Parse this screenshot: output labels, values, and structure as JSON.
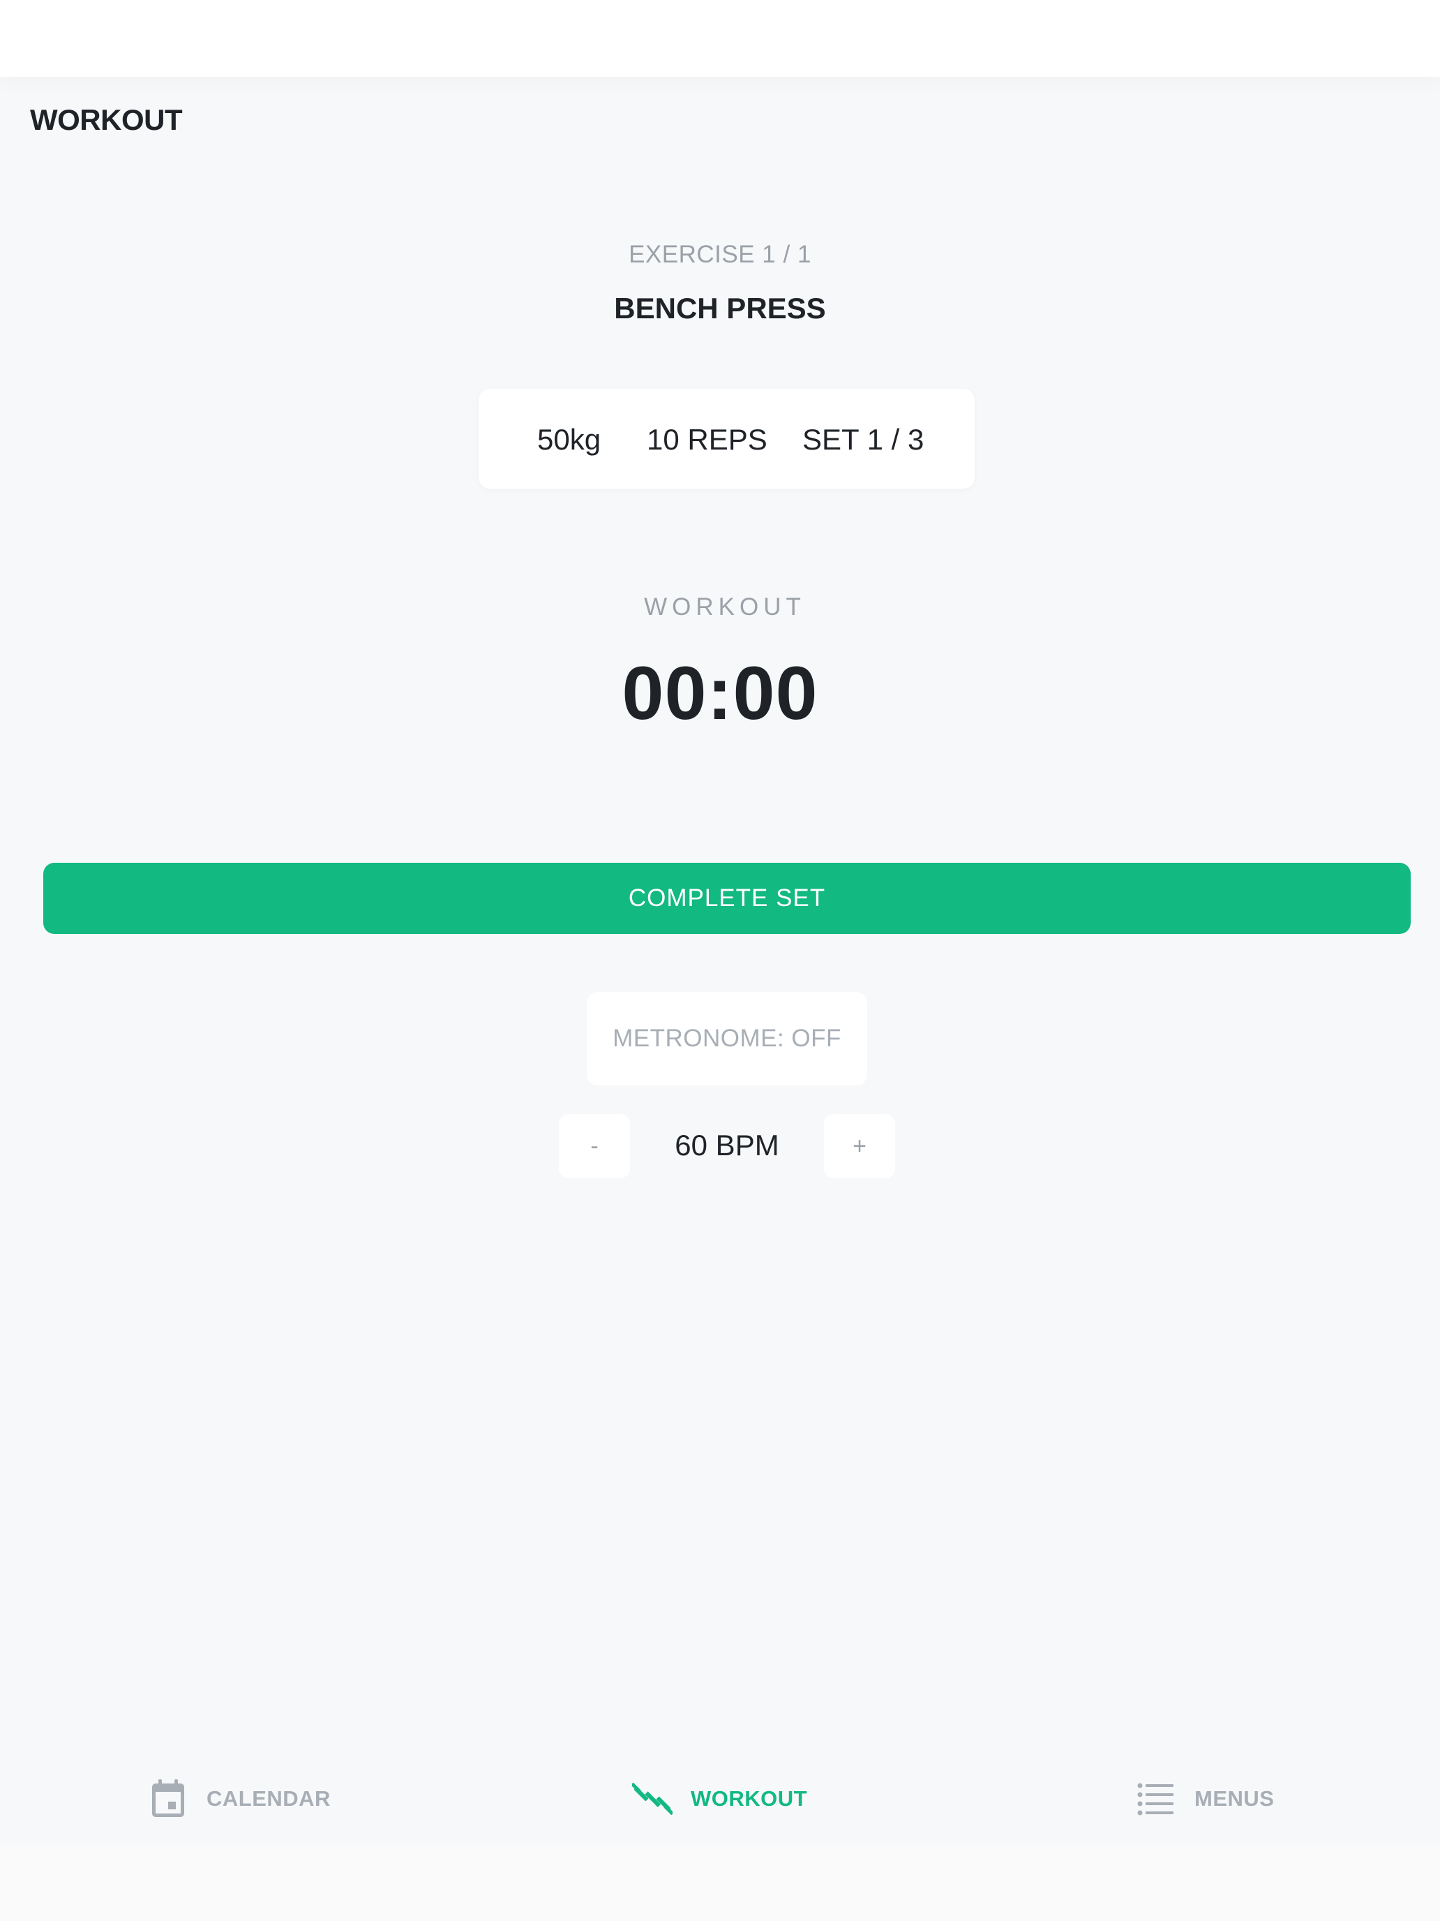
{
  "header": {
    "title": "WORKOUT"
  },
  "exercise": {
    "counter": "EXERCISE 1 / 1",
    "name": "BENCH PRESS"
  },
  "stats": {
    "weight": "50kg",
    "reps": "10 REPS",
    "set": "SET 1 / 3"
  },
  "timer": {
    "label": "WORKOUT",
    "value": "00:00"
  },
  "actions": {
    "complete_set_label": "COMPLETE SET"
  },
  "metronome": {
    "toggle_label": "METRONOME: OFF",
    "decrement_label": "-",
    "bpm": "60 BPM",
    "increment_label": "+"
  },
  "tabs": [
    {
      "label": "CALENDAR",
      "icon": "calendar-icon",
      "active": false
    },
    {
      "label": "WORKOUT",
      "icon": "dumbbell-icon",
      "active": true
    },
    {
      "label": "MENUS",
      "icon": "list-icon",
      "active": false
    }
  ],
  "colors": {
    "accent": "#12b981",
    "background": "#f7f8fa",
    "text_primary": "#1f2328",
    "text_muted": "#9ba1a8"
  }
}
